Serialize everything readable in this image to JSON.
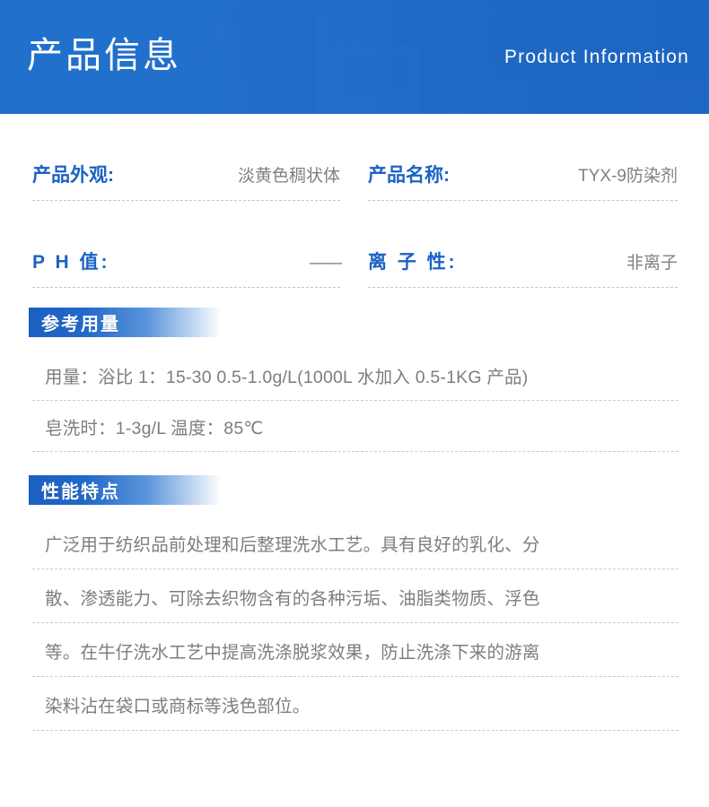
{
  "banner": {
    "title": "产品信息",
    "subtitle": "Product Information",
    "background_color": "#2170cc",
    "title_color": "#ffffff"
  },
  "specs": {
    "rows": [
      {
        "left": {
          "label": "产品外观:",
          "value": "淡黄色稠状体"
        },
        "right": {
          "label": "产品名称:",
          "value": "TYX-9防染剂"
        }
      },
      {
        "left": {
          "label": "P H 值:",
          "value": "——"
        },
        "right": {
          "label": "离 子 性:",
          "value": "非离子"
        }
      }
    ],
    "label_color": "#1b62c4",
    "value_color": "#808080"
  },
  "sections": [
    {
      "title": "参考用量",
      "lines": [
        "用量：浴比 1：15-30  0.5-1.0g/L(1000L 水加入 0.5-1KG 产品)",
        "皂洗时：1-3g/L  温度：85℃"
      ]
    },
    {
      "title": "性能特点",
      "lines": [
        "广泛用于纺织品前处理和后整理洗水工艺。具有良好的乳化、分",
        "散、渗透能力、可除去织物含有的各种污垢、油脂类物质、浮色",
        "等。在牛仔洗水工艺中提高洗涤脱浆效果，防止洗涤下来的游离",
        "染料沾在袋口或商标等浅色部位。"
      ]
    }
  ],
  "theme": {
    "accent_blue": "#1b5fc1",
    "banner_blue": "#2170cc",
    "body_text_gray": "#7d7d7d",
    "divider_gray": "#c8c8c8"
  }
}
